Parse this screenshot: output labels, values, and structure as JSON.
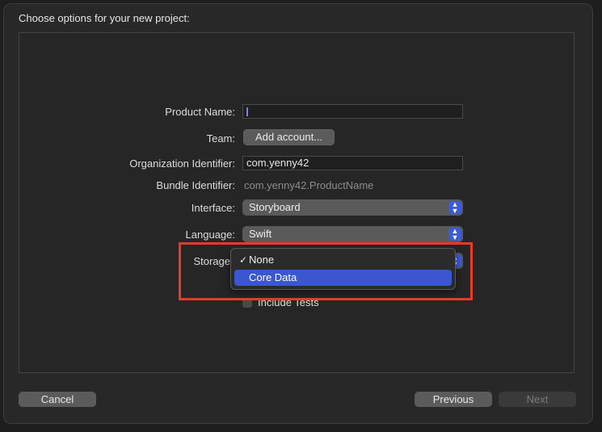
{
  "dialog": {
    "title": "Choose options for your new project:"
  },
  "form": {
    "product_name": {
      "label": "Product Name:",
      "value": ""
    },
    "team": {
      "label": "Team:",
      "button": "Add account..."
    },
    "organization_identifier": {
      "label": "Organization Identifier:",
      "value": "com.yenny42"
    },
    "bundle_identifier": {
      "label": "Bundle Identifier:",
      "value": "com.yenny42.ProductName"
    },
    "interface": {
      "label": "Interface:",
      "value": "Storyboard"
    },
    "language": {
      "label": "Language:",
      "value": "Swift"
    },
    "storage": {
      "label": "Storage",
      "options": [
        {
          "label": "None",
          "checked": true
        },
        {
          "label": "Core Data",
          "highlighted": true
        }
      ]
    },
    "include_tests": {
      "label": "Include Tests",
      "checked": false
    }
  },
  "footer": {
    "cancel": "Cancel",
    "previous": "Previous",
    "next": "Next"
  },
  "colors": {
    "accent": "#3b57d0",
    "annotation_box": "#e83a24"
  }
}
